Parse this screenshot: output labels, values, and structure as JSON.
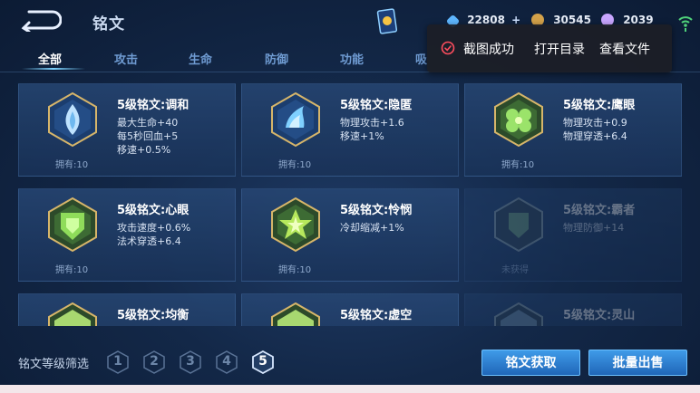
{
  "header": {
    "title": "铭文",
    "resources": [
      {
        "value": "22808",
        "icon": "diamond-icon",
        "color": "#5fb7ff"
      },
      {
        "value": "30545",
        "icon": "gold-coin-icon",
        "color": "#d4a24a"
      },
      {
        "value": "2039",
        "icon": "gem-icon",
        "color": "#c9a6ff"
      }
    ],
    "plus": "+"
  },
  "tabs": [
    "全部",
    "攻击",
    "生命",
    "防御",
    "功能",
    "吸"
  ],
  "toast": {
    "message": "截图成功",
    "open_folder": "打开目录",
    "view_file": "查看文件"
  },
  "inscriptions": [
    {
      "title": "5级铭文:调和",
      "stats": [
        "最大生命+40",
        "每5秒回血+5",
        "移速+0.5%"
      ],
      "owned": "拥有:10",
      "color": "#bfe3ff",
      "icon": "blue-flame-gem-icon"
    },
    {
      "title": "5级铭文:隐匿",
      "stats": [
        "物理攻击+1.6",
        "移速+1%"
      ],
      "owned": "拥有:10",
      "color": "#7fd0ff",
      "icon": "blue-wave-gem-icon"
    },
    {
      "title": "5级铭文:鹰眼",
      "stats": [
        "物理攻击+0.9",
        "物理穿透+6.4"
      ],
      "owned": "拥有:10",
      "color": "#9be36a",
      "icon": "green-clover-gem-icon"
    },
    {
      "title": "5级铭文:心眼",
      "stats": [
        "攻击速度+0.6%",
        "法术穿透+6.4"
      ],
      "owned": "拥有:10",
      "color": "#8fdc5a",
      "icon": "green-shield-gem-icon"
    },
    {
      "title": "5级铭文:怜悯",
      "stats": [
        "冷却缩减+1%"
      ],
      "owned": "拥有:10",
      "color": "#b6e85c",
      "icon": "green-star-gem-icon"
    },
    {
      "title": "5级铭文:霸者",
      "stats": [
        "物理防御+14"
      ],
      "owned": "未获得",
      "color": "#6fa07a",
      "icon": "locked-gem-icon"
    },
    {
      "title": "5级铭文:均衡",
      "stats": [],
      "owned": "",
      "color": "#a8d870",
      "icon": "green-gem-icon"
    },
    {
      "title": "5级铭文:虚空",
      "stats": [],
      "owned": "",
      "color": "#a8d870",
      "icon": "green-gem-icon"
    },
    {
      "title": "5级铭文:灵山",
      "stats": [],
      "owned": "",
      "color": "#6f8fa8",
      "icon": "locked-gem-icon"
    }
  ],
  "filter": {
    "label": "铭文等级筛选",
    "levels": [
      "1",
      "2",
      "3",
      "4",
      "5"
    ],
    "selected": "5"
  },
  "buttons": {
    "acquire": "铭文获取",
    "bulk_sell": "批量出售"
  }
}
